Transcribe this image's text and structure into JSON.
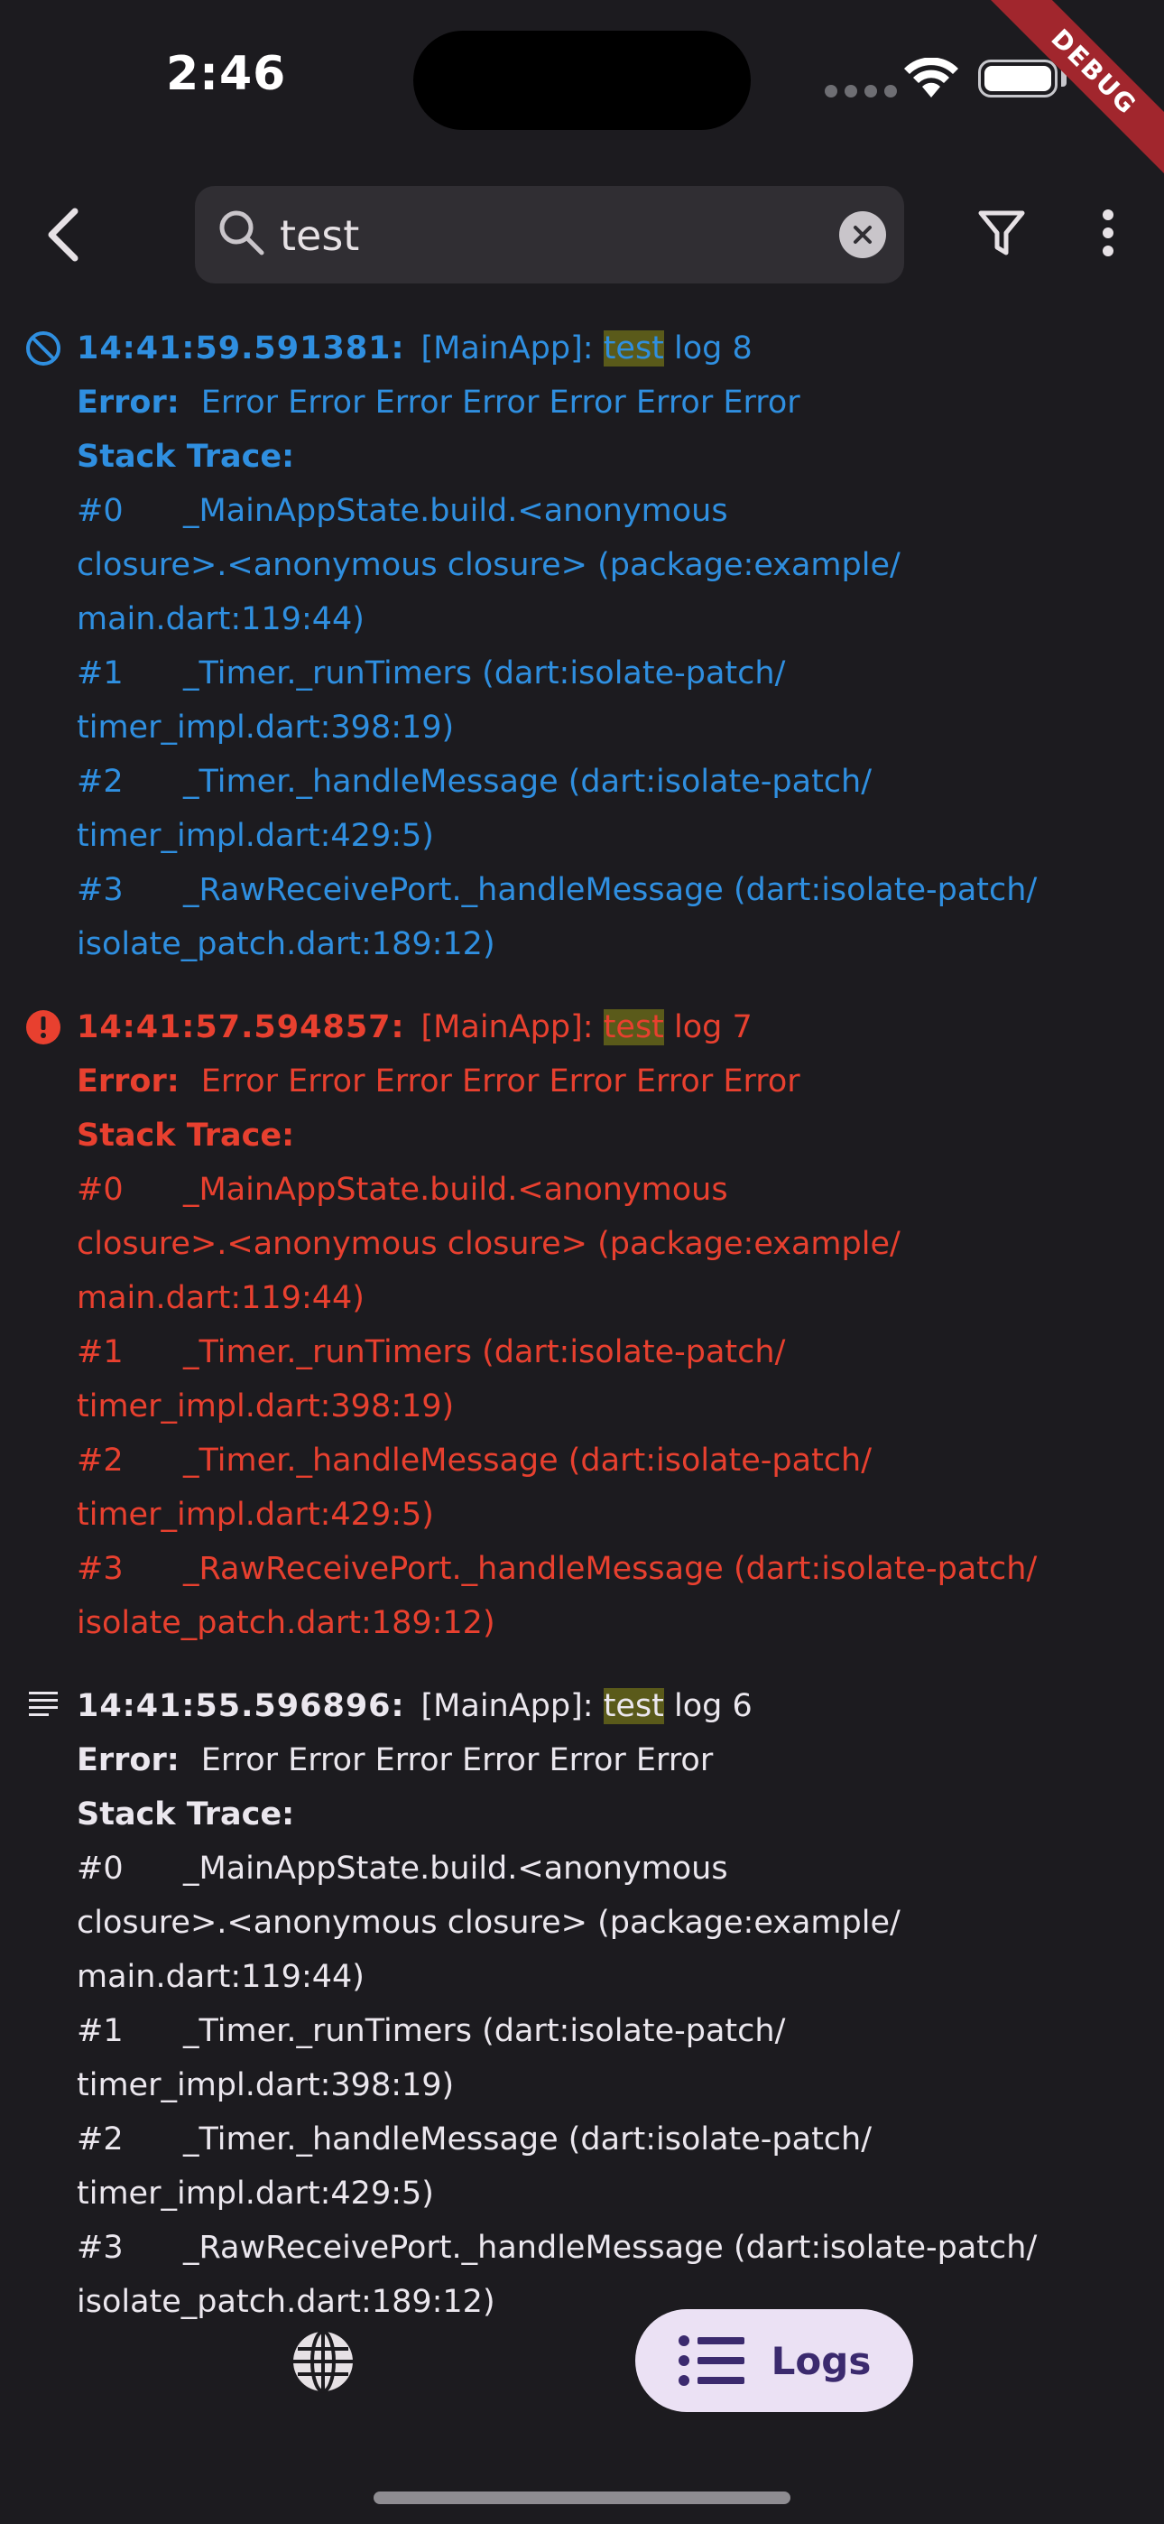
{
  "status_bar": {
    "time": "2:46",
    "debug_label": "DEBUG"
  },
  "app_bar": {
    "search": {
      "value": "test",
      "placeholder": ""
    },
    "back_icon": "chevron-left-icon",
    "filter_icon": "filter-icon",
    "more_icon": "more-vert-icon"
  },
  "colors": {
    "debug": "#2f8fe0",
    "error": "#e8402f",
    "info": "#ebe7ee",
    "highlight": "#5a5a1a"
  },
  "logs": [
    {
      "level_icon": "block-icon",
      "timestamp": "14:41:59.591381:",
      "prefix": "[MainApp]: ",
      "match": "test",
      "suffix": " log 8",
      "error_label": "Error:",
      "error_text": "Error Error Error Error Error Error Error",
      "stack_label": "Stack Trace:",
      "frames": [
        {
          "index": "#0",
          "lines": [
            "_MainAppState.build.<anonymous",
            "closure>.<anonymous closure> (package:example/",
            "main.dart:119:44)"
          ]
        },
        {
          "index": "#1",
          "lines": [
            "_Timer._runTimers (dart:isolate-patch/",
            "timer_impl.dart:398:19)"
          ]
        },
        {
          "index": "#2",
          "lines": [
            "_Timer._handleMessage (dart:isolate-patch/",
            "timer_impl.dart:429:5)"
          ]
        },
        {
          "index": "#3",
          "lines": [
            "_RawReceivePort._handleMessage (dart:isolate-patch/",
            "isolate_patch.dart:189:12)"
          ]
        }
      ]
    },
    {
      "level_icon": "error-icon",
      "timestamp": "14:41:57.594857:",
      "prefix": "[MainApp]: ",
      "match": "test",
      "suffix": " log 7",
      "error_label": "Error:",
      "error_text": "Error Error Error Error Error Error Error",
      "stack_label": "Stack Trace:",
      "frames": [
        {
          "index": "#0",
          "lines": [
            "_MainAppState.build.<anonymous",
            "closure>.<anonymous closure> (package:example/",
            "main.dart:119:44)"
          ]
        },
        {
          "index": "#1",
          "lines": [
            "_Timer._runTimers (dart:isolate-patch/",
            "timer_impl.dart:398:19)"
          ]
        },
        {
          "index": "#2",
          "lines": [
            "_Timer._handleMessage (dart:isolate-patch/",
            "timer_impl.dart:429:5)"
          ]
        },
        {
          "index": "#3",
          "lines": [
            "_RawReceivePort._handleMessage (dart:isolate-patch/",
            "isolate_patch.dart:189:12)"
          ]
        }
      ]
    },
    {
      "level_icon": "lines-icon",
      "timestamp": "14:41:55.596896:",
      "prefix": "[MainApp]: ",
      "match": "test",
      "suffix": " log 6",
      "error_label": "Error:",
      "error_text": "Error Error Error Error Error Error",
      "stack_label": "Stack Trace:",
      "frames": [
        {
          "index": "#0",
          "lines": [
            "_MainAppState.build.<anonymous",
            "closure>.<anonymous closure> (package:example/",
            "main.dart:119:44)"
          ]
        },
        {
          "index": "#1",
          "lines": [
            "_Timer._runTimers (dart:isolate-patch/",
            "timer_impl.dart:398:19)"
          ]
        },
        {
          "index": "#2",
          "lines": [
            "_Timer._handleMessage (dart:isolate-patch/",
            "timer_impl.dart:429:5)"
          ]
        },
        {
          "index": "#3",
          "lines": [
            "_RawReceivePort._handleMessage (dart:isolate-patch/",
            "isolate_patch.dart:189:12)"
          ]
        }
      ]
    }
  ],
  "bottom_nav": {
    "web_icon": "globe-icon",
    "logs_icon": "list-icon",
    "logs_label": "Logs"
  }
}
